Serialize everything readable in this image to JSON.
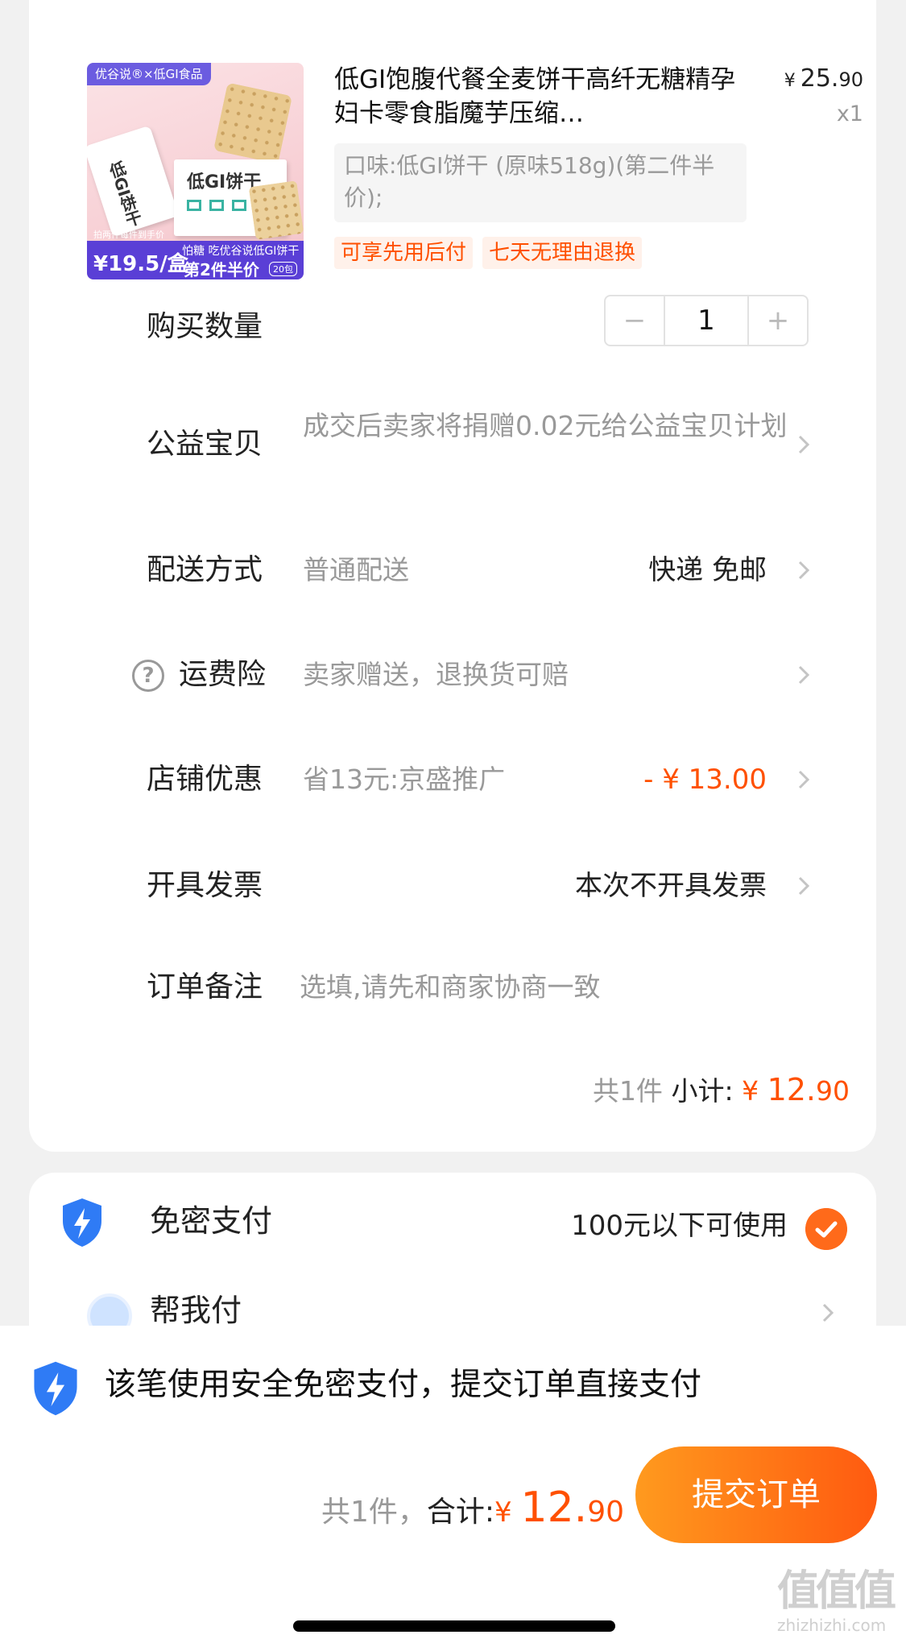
{
  "product": {
    "thumb": {
      "brand": "优谷说®×低GI食品",
      "box_title": "低GI饼干",
      "pouch_text": "低GI饼干",
      "price": "¥19.5/盒",
      "price_note": "拍两件每件到手价",
      "slogan": "怕糖 吃优谷说低GI饼干",
      "promo": "第2件半价",
      "count": "20包"
    },
    "title": "低GI饱腹代餐全麦饼干高纤无糖精孕妇卡零食脂魔芋压缩…",
    "price_yen": "¥",
    "price_main": "25.",
    "price_cents": "90",
    "qty": "x1",
    "spec": "口味:低GI饼干 (原味518g)(第二件半价);",
    "tags": [
      "可享先用后付",
      "七天无理由退换"
    ]
  },
  "rows": {
    "quantity": {
      "label": "购买数量",
      "value": "1",
      "minus": "−",
      "plus": "+"
    },
    "charity": {
      "label": "公益宝贝",
      "value": "成交后卖家将捐赠0.02元给公益宝贝计划"
    },
    "delivery": {
      "label": "配送方式",
      "value": "普通配送",
      "right": "快递 免邮"
    },
    "insurance": {
      "label": "运费险",
      "value": "卖家赠送，退换货可赔",
      "help": "?"
    },
    "discount": {
      "label": "店铺优惠",
      "value": "省13元:京盛推广",
      "right": "- ¥ 13.00"
    },
    "invoice": {
      "label": "开具发票",
      "right": "本次不开具发票"
    },
    "note": {
      "label": "订单备注",
      "placeholder": "选填,请先和商家协商一致"
    }
  },
  "subtotal": {
    "count": "共1件",
    "label": "小计:",
    "yen": "¥ ",
    "main": "12.",
    "cents": "90"
  },
  "payment": {
    "title": "免密支付",
    "note": "100元以下可使用",
    "help_pay": "帮我付"
  },
  "bottom": {
    "secure_text": "该笔使用安全免密支付，提交订单直接支付",
    "count": "共1件，",
    "label": "合计:",
    "yen": "¥ ",
    "main": "12.",
    "cents": "90",
    "submit": "提交订单"
  },
  "watermark": {
    "glyphs": "值值值",
    "site": "zhizhizhi.com"
  },
  "colors": {
    "accent": "#ff5000",
    "button_start": "#ff9a1e",
    "button_end": "#ff5a10",
    "shield": "#2f7bf5"
  }
}
